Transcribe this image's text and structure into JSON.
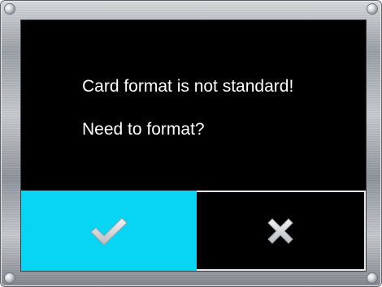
{
  "dialog": {
    "message_line_1": "Card format is not standard!",
    "message_line_2": "Need to format?"
  },
  "buttons": {
    "confirm_icon": "checkmark-icon",
    "cancel_icon": "close-icon"
  },
  "colors": {
    "confirm_bg": "#08d4f3",
    "cancel_bg": "#000000",
    "screen_bg": "#000000",
    "icon": "#d6d9dc"
  }
}
